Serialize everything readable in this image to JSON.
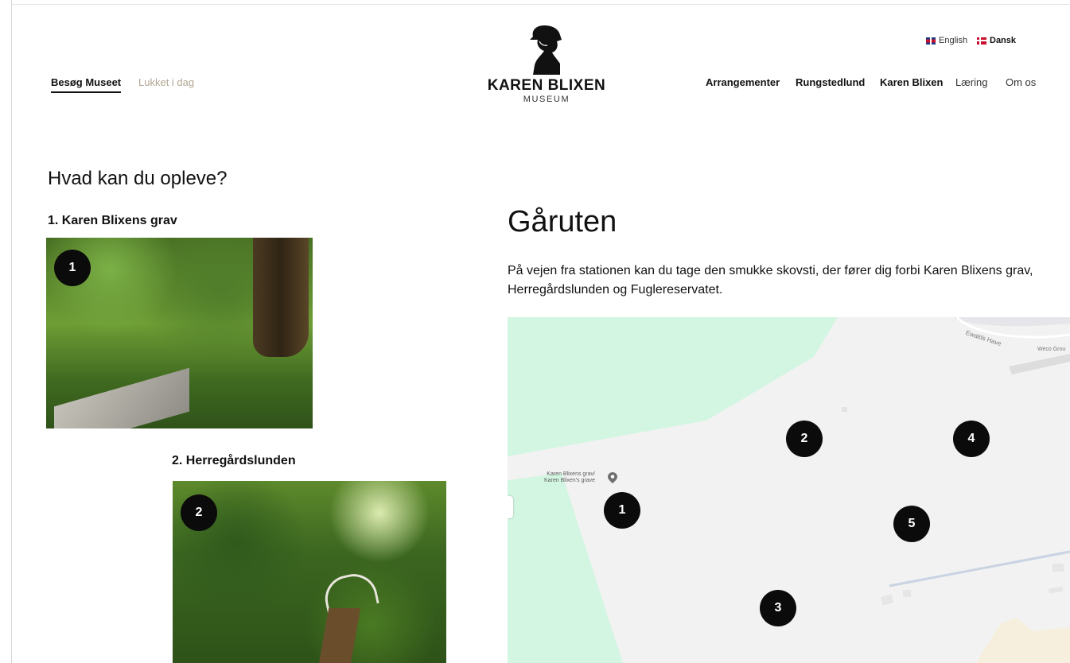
{
  "header": {
    "visit_link": "Besøg Museet",
    "status": "Lukket i dag",
    "logo": {
      "title": "KAREN BLIXEN",
      "subtitle": "MUSEUM",
      "icon": "karen-blixen-silhouette"
    },
    "languages": [
      {
        "label": "English",
        "flag": "uk-flag"
      },
      {
        "label": "Dansk",
        "flag": "denmark-flag"
      }
    ],
    "nav": [
      "Arrangementer",
      "Rungstedlund",
      "Karen Blixen",
      "Læring",
      "Om os"
    ]
  },
  "left": {
    "heading": "Hvad kan du opleve?",
    "items": [
      {
        "number": "1",
        "title": "1. Karen Blixens grav"
      },
      {
        "number": "2",
        "title": "2. Herregårdslunden"
      }
    ]
  },
  "route": {
    "title": "Gåruten",
    "description": "På vejen fra stationen kan du tage den smukke skovsti, der fører dig forbi Karen Blixens grav, Herregårdslunden og Fuglereservatet."
  },
  "map": {
    "pin_label_line1": "Karen Blixens grav/",
    "pin_label_line2": "Karen Blixen's grave",
    "street": "Ewalds Have",
    "place": "Weco Grou",
    "markers": [
      "1",
      "2",
      "3",
      "4",
      "5"
    ]
  },
  "colors": {
    "accent": "#b0a591",
    "map_green": "#d3f6e2",
    "map_bg": "#f2f2f2",
    "marker": "#0b0b0b"
  }
}
